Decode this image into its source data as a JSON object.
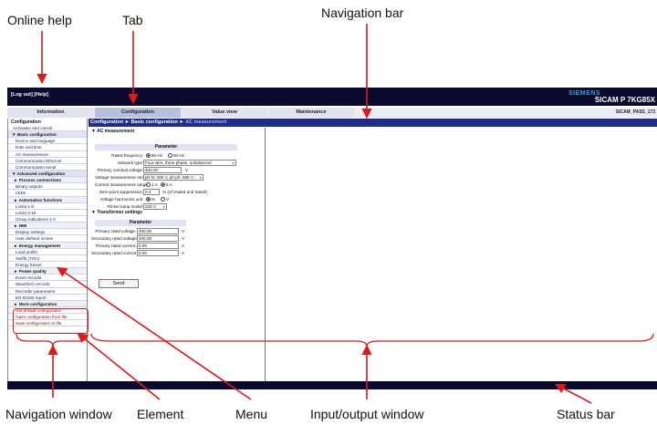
{
  "callouts": {
    "online_help": "Online help",
    "tab": "Tab",
    "navigation_bar": "Navigation bar",
    "navigation_window": "Navigation window",
    "element": "Element",
    "menu": "Menu",
    "input_output_window": "Input/output window",
    "status_bar": "Status bar"
  },
  "header": {
    "links": "[Log out] [Help]",
    "brand": "SIEMENS",
    "product": "SICAM P 7KG85X"
  },
  "tabs": [
    {
      "label": "Information"
    },
    {
      "label": "Configuration"
    },
    {
      "label": "Value view"
    },
    {
      "label": "Maintenance"
    }
  ],
  "device_name": "SICAM_PASS_173",
  "breadcrumb": "Configuration ► Basic configuration ► ",
  "breadcrumb_current": "AC measurement",
  "sidebar": {
    "title": "Configuration",
    "items": [
      {
        "label": "Activation and cancel"
      },
      {
        "label": "▼ Basic configuration"
      },
      {
        "label": "Device and language"
      },
      {
        "label": "Date and time"
      },
      {
        "label": "AC measurement"
      },
      {
        "label": "Communication Ethernet"
      },
      {
        "label": "Communication serial"
      },
      {
        "label": "▼ Advanced configuration"
      },
      {
        "label": "► Process connections"
      },
      {
        "label": "Binary outputs"
      },
      {
        "label": "LEDs"
      },
      {
        "label": "► Automation functions"
      },
      {
        "label": "Limits 1-8"
      },
      {
        "label": "Limits 9-16"
      },
      {
        "label": "Group indications 1-4"
      },
      {
        "label": "► HMI"
      },
      {
        "label": "Display settings"
      },
      {
        "label": "User-defined screen"
      },
      {
        "label": "► Energy management"
      },
      {
        "label": "Load profile"
      },
      {
        "label": "Tariffs (TOU)"
      },
      {
        "label": "Energy freeze"
      },
      {
        "label": "► Power quality"
      },
      {
        "label": "Event records"
      },
      {
        "label": "Waveform records"
      },
      {
        "label": "Recorder parameters"
      },
      {
        "label": "EN 50160 report"
      },
      {
        "label": "► More configuration"
      },
      {
        "label": "Get default configuration"
      },
      {
        "label": "Open configuration from file"
      },
      {
        "label": "Save configuration to file"
      }
    ]
  },
  "ac": {
    "section": "▼ AC measurement",
    "param_header": "Parameter",
    "rated_frequency_label": "Rated frequency",
    "rated_frequency_options": [
      "50 Hz",
      "60 Hz"
    ],
    "rated_frequency_selected": "50 Hz",
    "network_type_label": "Network type",
    "network_type_value": "Four-wire, three phase, unbalanced",
    "primary_voltage_label": "Primary nominal voltage",
    "primary_voltage_value": "400.00",
    "primary_voltage_unit": "V",
    "voltage_range_label": "Voltage measurement range",
    "voltage_range_value": "ph-N: 400 V, ph-ph: 690 V",
    "current_range_label": "Current measurement range",
    "current_range_options": [
      "1 A",
      "5 A"
    ],
    "current_range_selected": "5 A",
    "zero_point_label": "Zero-point suppression",
    "zero_point_value": "0.3",
    "zero_point_unit": "% (of Vrated and Irated)",
    "harmonics_label": "Voltage harmonics unit",
    "harmonics_options": [
      "%",
      "V"
    ],
    "harmonics_selected": "%",
    "flicker_label": "Flicker lamp model",
    "flicker_value": "230 V"
  },
  "transformer": {
    "section": "▼ Transformer settings",
    "param_header": "Parameter",
    "rows": [
      {
        "label": "Primary rated voltage",
        "value": "400.00",
        "unit": "V"
      },
      {
        "label": "Secondary rated voltage",
        "value": "400.00",
        "unit": "V"
      },
      {
        "label": "Primary rated current",
        "value": "5.00",
        "unit": "A"
      },
      {
        "label": "Secondary rated current",
        "value": "5.00",
        "unit": "A"
      }
    ]
  },
  "send_label": "Send"
}
